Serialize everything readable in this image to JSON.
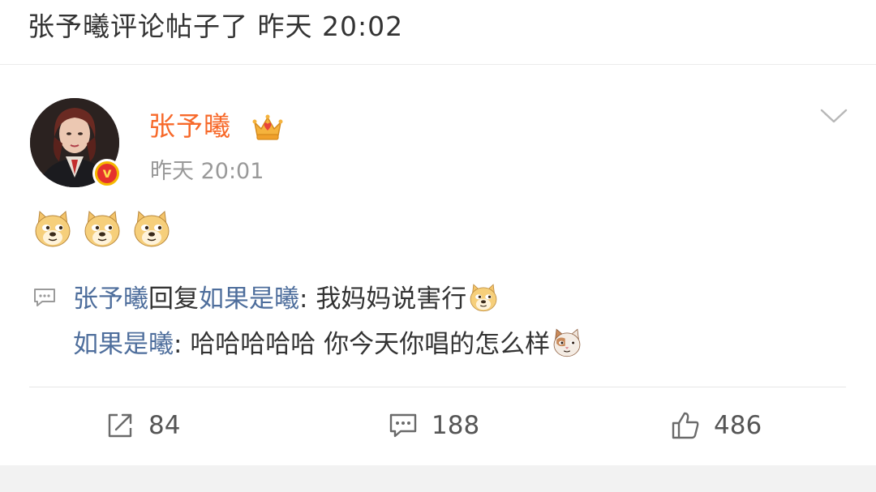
{
  "header": {
    "title": "张予曦评论帖子了 昨天 20:02"
  },
  "post": {
    "username": "张予曦",
    "time": "昨天 20:01",
    "emojis": [
      "doge-icon",
      "doge-icon",
      "doge-icon"
    ]
  },
  "replies": [
    {
      "author": "张予曦",
      "action": "回复",
      "target": "如果是曦",
      "separator": ": ",
      "text": "我妈妈说害行",
      "emoji": "doge-icon"
    },
    {
      "author": "如果是曦",
      "separator": ": ",
      "text": "哈哈哈哈哈 你今天你唱的怎么样",
      "emoji": "cat-icon"
    }
  ],
  "actions": {
    "repost": {
      "icon": "repost-icon",
      "count": "84"
    },
    "comment": {
      "icon": "comment-icon",
      "count": "188"
    },
    "like": {
      "icon": "thumbs-up-icon",
      "count": "486"
    }
  },
  "colors": {
    "username": "#f7692a",
    "link": "#4e6e9c",
    "meta": "#999999",
    "text": "#333333",
    "verified_badge": "#f5b800"
  }
}
